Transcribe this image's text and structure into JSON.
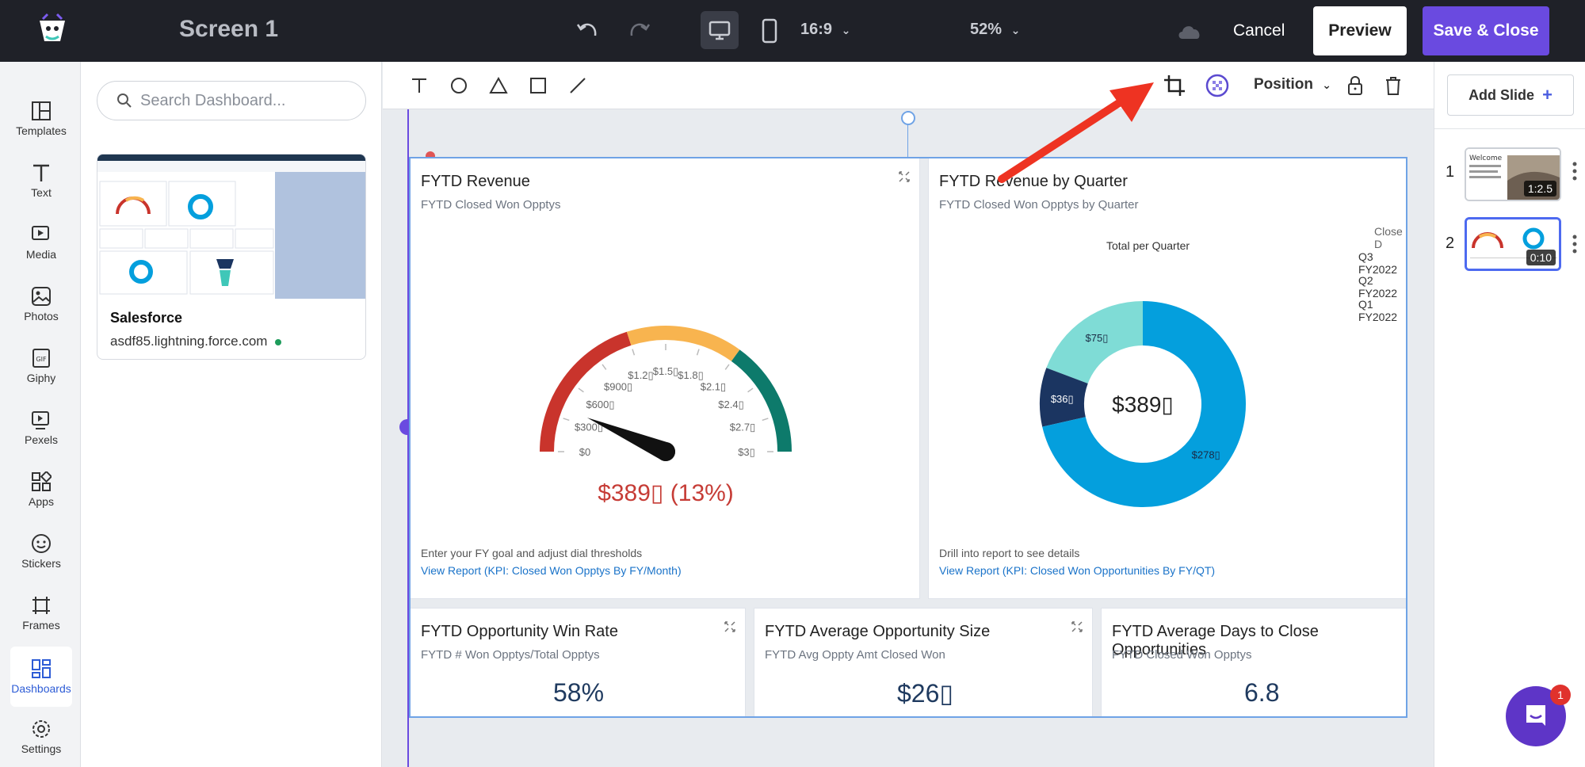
{
  "topbar": {
    "screen_title": "Screen 1",
    "aspect_ratio": "16:9",
    "zoom": "52%",
    "cancel_label": "Cancel",
    "preview_label": "Preview",
    "save_label": "Save & Close"
  },
  "rail": {
    "items": [
      {
        "label": "Templates",
        "icon": "templates-icon"
      },
      {
        "label": "Text",
        "icon": "text-icon"
      },
      {
        "label": "Media",
        "icon": "media-icon"
      },
      {
        "label": "Photos",
        "icon": "photos-icon"
      },
      {
        "label": "Giphy",
        "icon": "gif-icon"
      },
      {
        "label": "Pexels",
        "icon": "pexels-icon"
      },
      {
        "label": "Apps",
        "icon": "apps-icon"
      },
      {
        "label": "Stickers",
        "icon": "stickers-icon"
      },
      {
        "label": "Frames",
        "icon": "frames-icon"
      },
      {
        "label": "Dashboards",
        "icon": "dashboards-icon"
      },
      {
        "label": "Settings",
        "icon": "settings-icon"
      }
    ],
    "active": "Dashboards"
  },
  "panel": {
    "search_placeholder": "Search Dashboard...",
    "card_name": "Salesforce",
    "card_url": "asdf85.lightning.force.com"
  },
  "toolbar": {
    "position_label": "Position"
  },
  "slides": {
    "add_label": "Add Slide",
    "items": [
      {
        "num": "1",
        "duration": "1:2.5"
      },
      {
        "num": "2",
        "duration": "0:10"
      }
    ]
  },
  "widgets": {
    "revenue": {
      "title": "FYTD Revenue",
      "subtitle": "FYTD Closed Won Opptys",
      "value": "$389▯ (13%)",
      "ticks": [
        "$0",
        "$300▯",
        "$600▯",
        "$900▯",
        "$1.2▯",
        "$1.5▯",
        "$1.8▯",
        "$2.1▯",
        "$2.4▯",
        "$2.7▯",
        "$3▯"
      ],
      "note": "Enter your FY goal and adjust dial thresholds",
      "link": "View Report (KPI: Closed Won Opptys By FY/Month)"
    },
    "quarter": {
      "title": "FYTD Revenue by Quarter",
      "subtitle": "FYTD Closed Won Opptys by Quarter",
      "chart_title": "Total per Quarter",
      "center_value": "$389▯",
      "legend_title": "Close D",
      "legend": [
        "Q3 FY2022",
        "Q2 FY2022",
        "Q1 FY2022"
      ],
      "slice_labels": [
        "$75▯",
        "$36▯",
        "$278▯"
      ],
      "note": "Drill into report to see details",
      "link": "View Report (KPI: Closed Won Opportunities By FY/QT)"
    },
    "winrate": {
      "title": "FYTD Opportunity Win Rate",
      "subtitle": "FYTD # Won Opptys/Total Opptys",
      "value": "58%"
    },
    "avgsize": {
      "title": "FYTD Average Opportunity Size",
      "subtitle": "FYTD Avg Oppty Amt Closed Won",
      "value": "$26▯"
    },
    "avgdays": {
      "title": "FYTD Average Days to Close Opportunities",
      "subtitle": "FYTD Closed Won Opptys",
      "value": "6.8"
    }
  },
  "chart_data": [
    {
      "type": "gauge",
      "title": "FYTD Revenue",
      "value_label": "$389▯ (13%)",
      "value_fraction": 0.13,
      "bands": [
        {
          "from": 0,
          "to": 0.4,
          "color": "#c9342c"
        },
        {
          "from": 0.4,
          "to": 0.7,
          "color": "#f8b44f"
        },
        {
          "from": 0.7,
          "to": 1.0,
          "color": "#0d7a6b"
        }
      ],
      "tick_labels": [
        "$0",
        "$300▯",
        "$600▯",
        "$900▯",
        "$1.2▯",
        "$1.5▯",
        "$1.8▯",
        "$2.1▯",
        "$2.4▯",
        "$2.7▯",
        "$3▯"
      ]
    },
    {
      "type": "pie",
      "title": "Total per Quarter",
      "categories": [
        "Q3 FY2022",
        "Q2 FY2022",
        "Q1 FY2022"
      ],
      "values": [
        75,
        36,
        278
      ],
      "colors": [
        "#7fdcd6",
        "#1b3561",
        "#049fdd"
      ]
    }
  ],
  "notification_count": "1"
}
